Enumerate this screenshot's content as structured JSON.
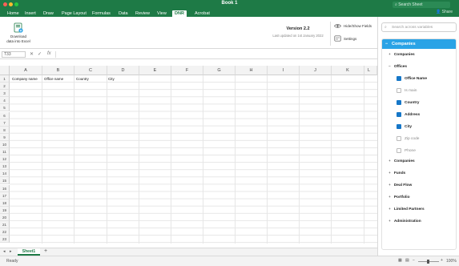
{
  "window": {
    "title": "Book 1",
    "search_placeholder": "Search Sheet"
  },
  "ribbon_tabs": [
    "Home",
    "Insert",
    "Draw",
    "Page Layout",
    "Formulas",
    "Data",
    "Review",
    "View",
    "DNR",
    "Acrobat"
  ],
  "share_label": "Share",
  "ribbon": {
    "download_label": "Download data into Excel",
    "version": "Version 2.2",
    "last_updated": "Last updated on 1st January 2022",
    "hide_show_label": "Hide/Show Fields",
    "settings_label": "Settings"
  },
  "formula_bar": {
    "name_box": "T33",
    "fx": "fx",
    "value": ""
  },
  "columns": [
    "A",
    "B",
    "C",
    "D",
    "E",
    "F",
    "G",
    "H",
    "I",
    "J",
    "K",
    "L"
  ],
  "rows": [
    "1",
    "2",
    "3",
    "4",
    "5",
    "6",
    "7",
    "8",
    "9",
    "10",
    "11",
    "12",
    "13",
    "14",
    "15",
    "16",
    "17",
    "18",
    "19",
    "20",
    "21",
    "22",
    "23"
  ],
  "header_cells": [
    "Company name",
    "Office name",
    "Country",
    "City"
  ],
  "sheet_tab": "Sheet1",
  "status": {
    "ready": "Ready",
    "zoom": "100%"
  },
  "panel": {
    "search_placeholder": "Search across variables",
    "header": "Companies",
    "items": [
      {
        "label": "Companies",
        "type": "collapsed"
      },
      {
        "label": "Offices",
        "type": "expanded"
      },
      {
        "label": "Office Name",
        "type": "checked"
      },
      {
        "label": "Is main",
        "type": "unchecked"
      },
      {
        "label": "Country",
        "type": "checked"
      },
      {
        "label": "Address",
        "type": "checked"
      },
      {
        "label": "City",
        "type": "checked"
      },
      {
        "label": "Zip code",
        "type": "unchecked"
      },
      {
        "label": "Phone",
        "type": "unchecked"
      },
      {
        "label": "Companies",
        "type": "collapsed"
      },
      {
        "label": "Funds",
        "type": "collapsed"
      },
      {
        "label": "Deal Flow",
        "type": "collapsed"
      },
      {
        "label": "Portfolio",
        "type": "collapsed"
      },
      {
        "label": "Limited Partners",
        "type": "collapsed"
      },
      {
        "label": "Administration",
        "type": "collapsed"
      }
    ]
  },
  "colors": {
    "excel_green": "#1e7a46",
    "panel_blue": "#2aa3e6",
    "check_blue": "#1677c8"
  }
}
